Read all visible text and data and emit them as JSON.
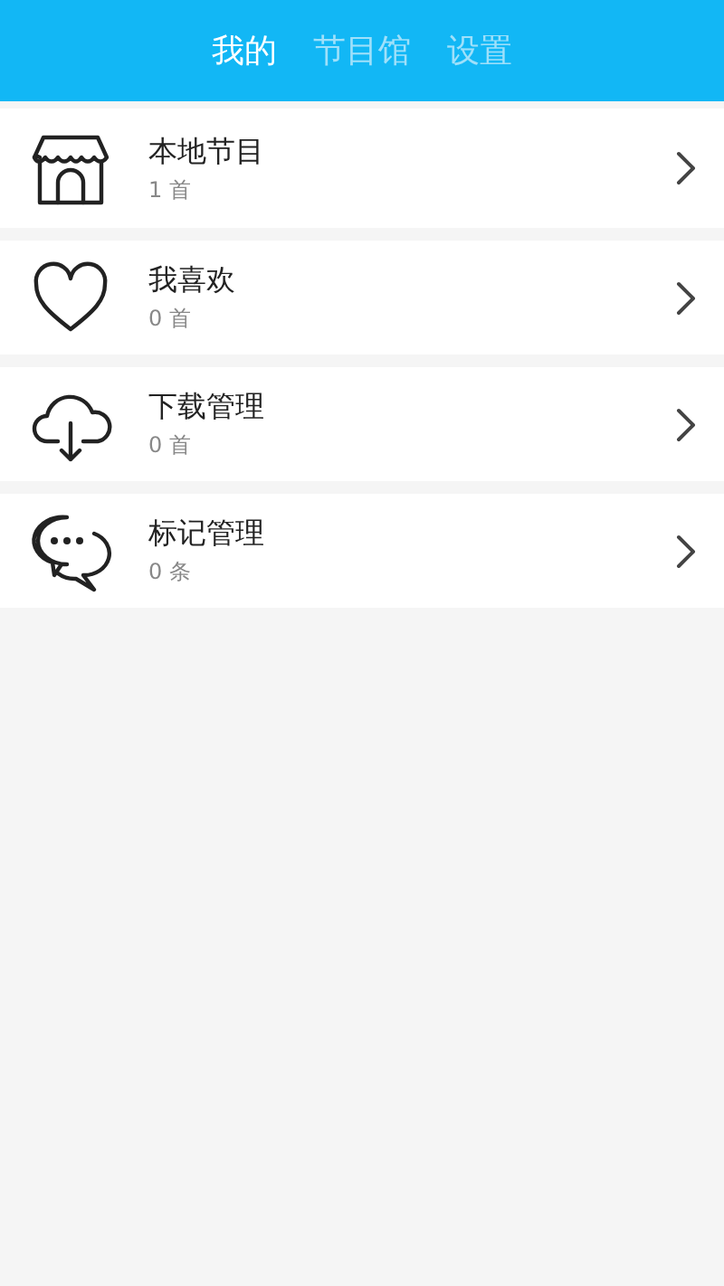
{
  "tabs": [
    {
      "label": "我的",
      "selected": true
    },
    {
      "label": "节目馆",
      "selected": false
    },
    {
      "label": "设置",
      "selected": false
    }
  ],
  "items": [
    {
      "title": "本地节目",
      "count": "1 首"
    },
    {
      "title": "我喜欢",
      "count": "0 首"
    },
    {
      "title": "下载管理",
      "count": "0 首"
    },
    {
      "title": "标记管理",
      "count": "0 条"
    }
  ]
}
